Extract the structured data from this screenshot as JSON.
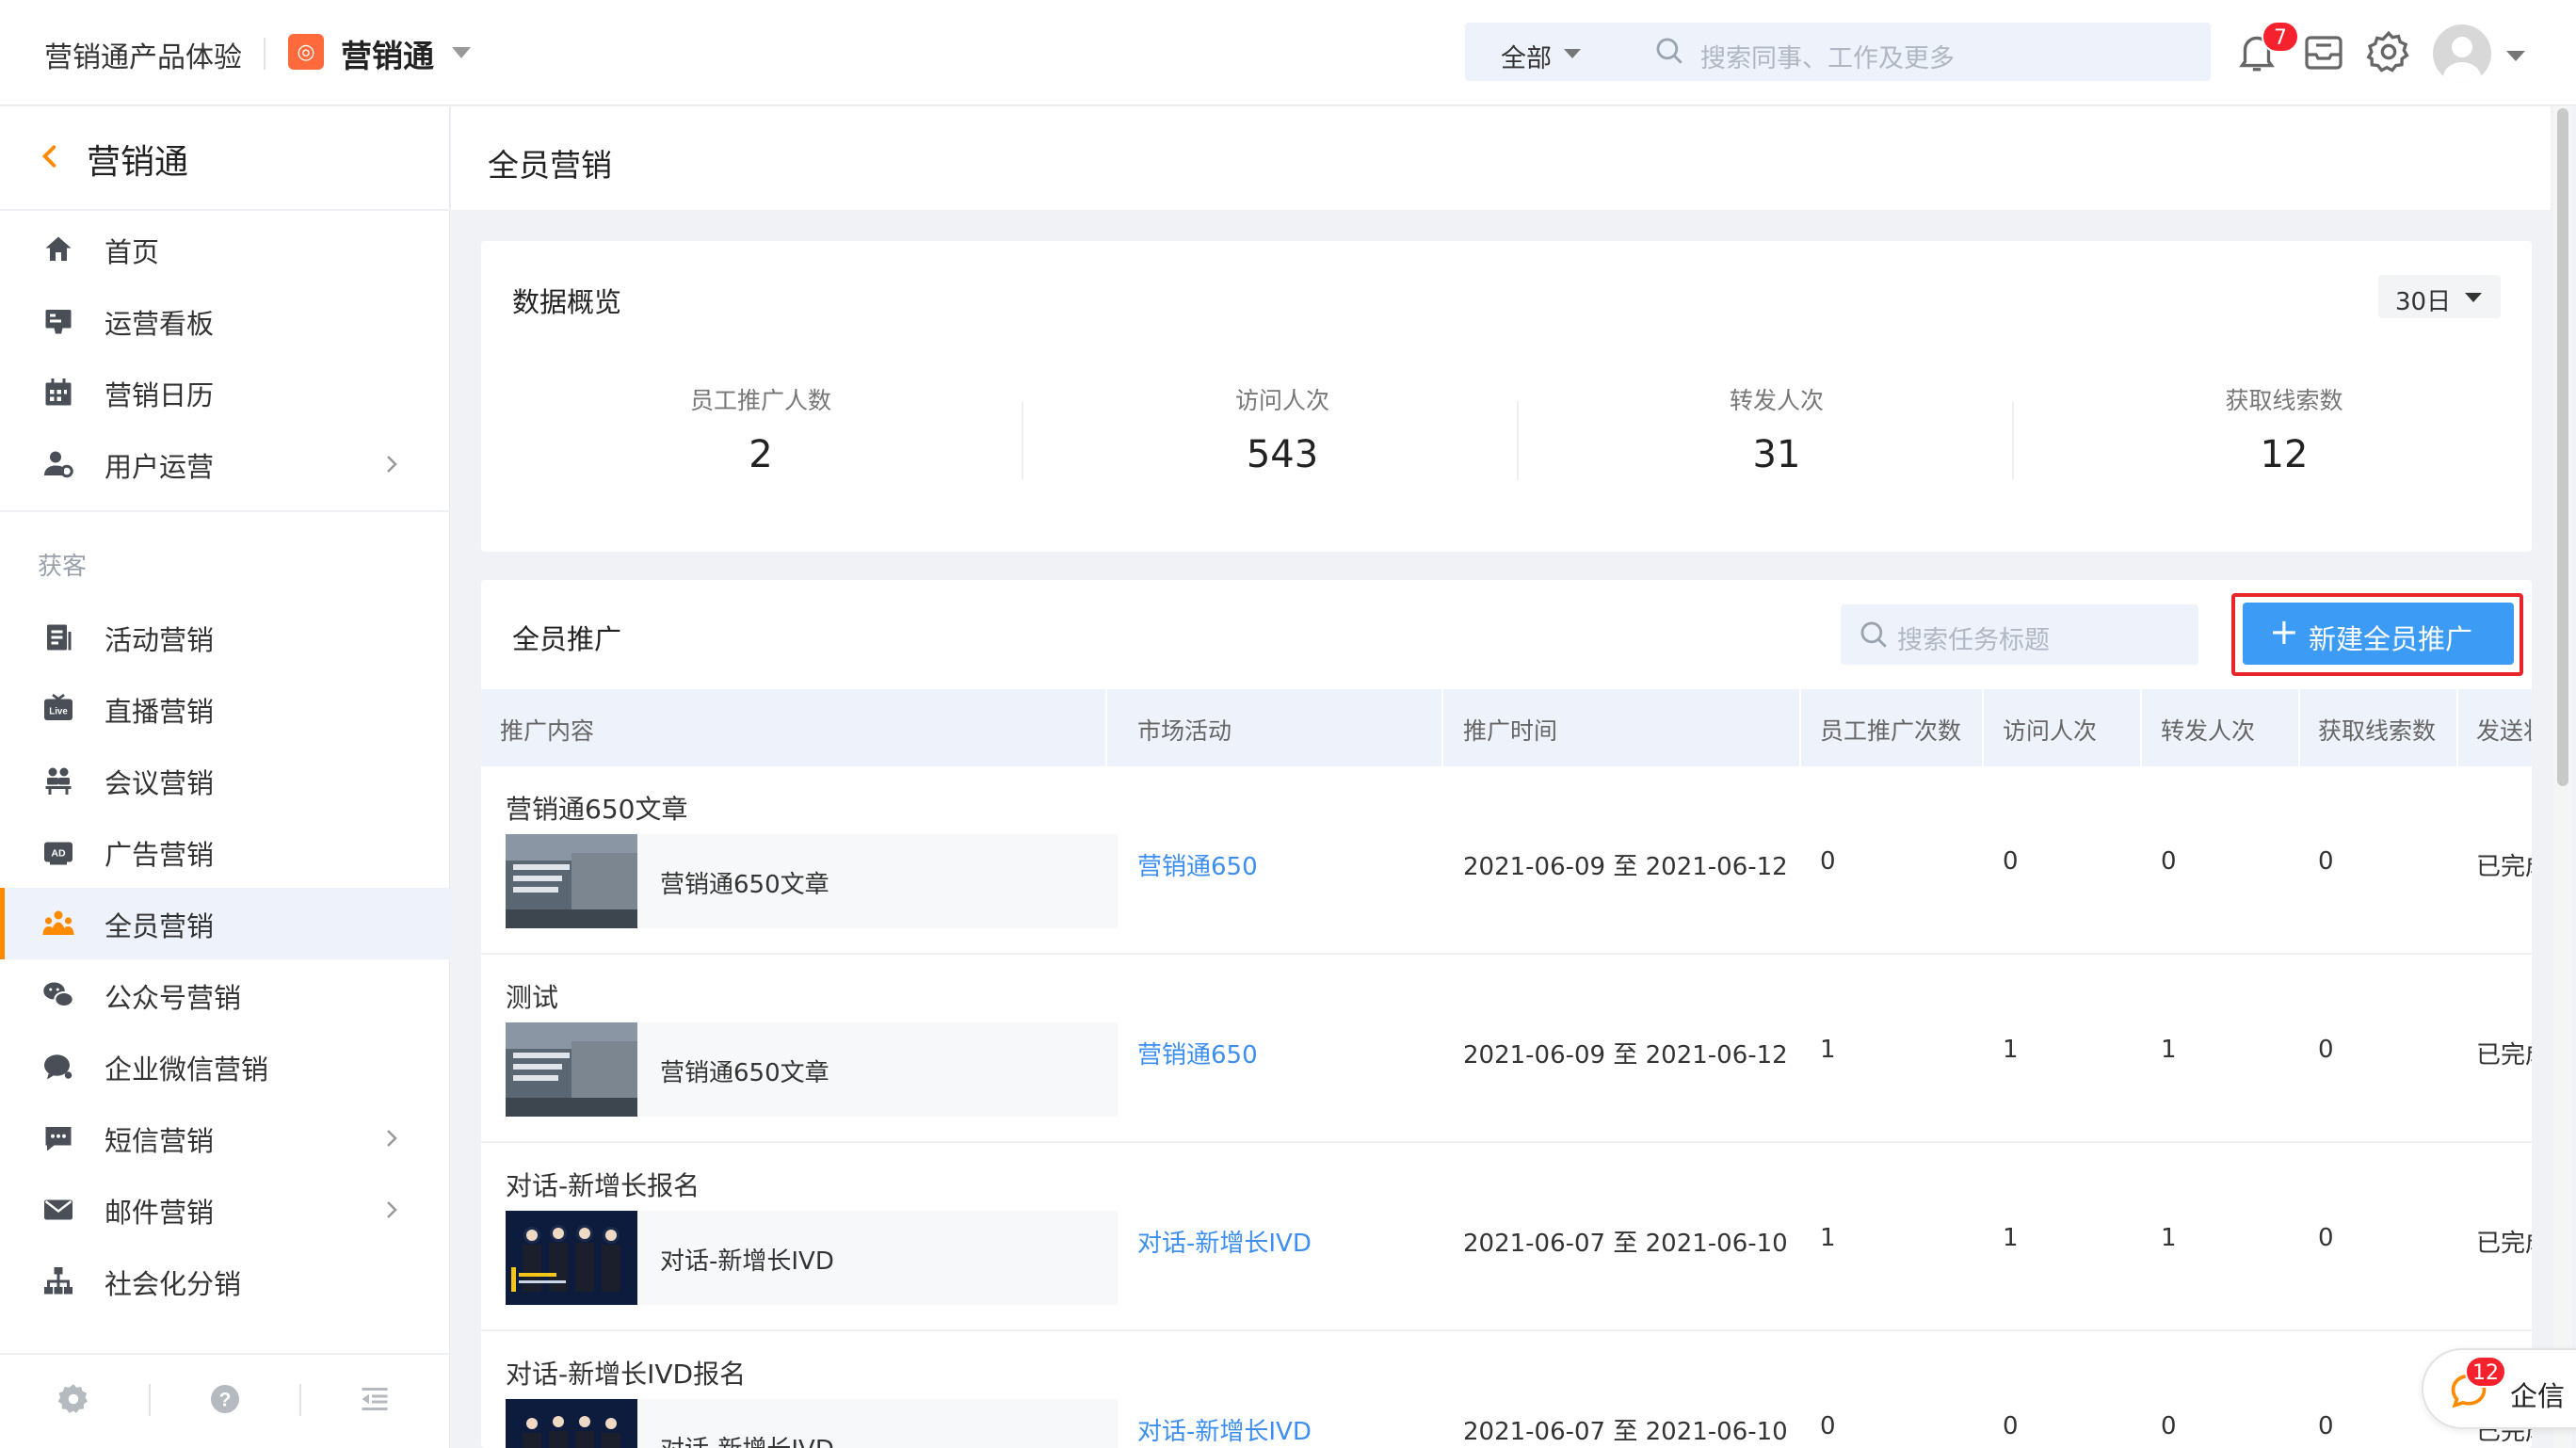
{
  "header": {
    "org": "营销通产品体验",
    "app_name": "营销通",
    "search_scope": "全部",
    "search_placeholder": "搜索同事、工作及更多",
    "notification_count": "7"
  },
  "sidebar": {
    "title": "营销通",
    "items_top": [
      {
        "label": "首页",
        "icon": "home-icon"
      },
      {
        "label": "运营看板",
        "icon": "dashboard-icon"
      },
      {
        "label": "营销日历",
        "icon": "calendar-icon"
      },
      {
        "label": "用户运营",
        "icon": "user-ops-icon",
        "expandable": true
      }
    ],
    "group_label": "获客",
    "items_acq": [
      {
        "label": "活动营销",
        "icon": "activity-icon"
      },
      {
        "label": "直播营销",
        "icon": "live-icon"
      },
      {
        "label": "会议营销",
        "icon": "meeting-icon"
      },
      {
        "label": "广告营销",
        "icon": "ad-icon"
      },
      {
        "label": "全员营销",
        "icon": "team-icon",
        "active": true
      },
      {
        "label": "公众号营销",
        "icon": "wechat-icon"
      },
      {
        "label": "企业微信营销",
        "icon": "wecom-icon"
      },
      {
        "label": "短信营销",
        "icon": "sms-icon",
        "expandable": true
      },
      {
        "label": "邮件营销",
        "icon": "mail-icon",
        "expandable": true
      },
      {
        "label": "社会化分销",
        "icon": "distribution-icon"
      }
    ]
  },
  "page": {
    "title": "全员营销"
  },
  "overview": {
    "title": "数据概览",
    "range": "30日",
    "stats": [
      {
        "label": "员工推广人数",
        "value": "2"
      },
      {
        "label": "访问人次",
        "value": "543"
      },
      {
        "label": "转发人次",
        "value": "31"
      },
      {
        "label": "获取线索数",
        "value": "12"
      }
    ]
  },
  "promotion": {
    "title": "全员推广",
    "search_placeholder": "搜索任务标题",
    "new_button": "新建全员推广",
    "columns": [
      "推广内容",
      "市场活动",
      "推广时间",
      "员工推广次数",
      "访问人次",
      "转发人次",
      "获取线索数",
      "发送状"
    ],
    "rows": [
      {
        "title": "营销通650文章",
        "card": "营销通650文章",
        "campaign": "营销通650",
        "time": "2021-06-09 至 2021-06-12",
        "pushes": "0",
        "visits": "0",
        "forwards": "0",
        "leads": "0",
        "status": "已完成"
      },
      {
        "title": "测试",
        "card": "营销通650文章",
        "campaign": "营销通650",
        "time": "2021-06-09 至 2021-06-12",
        "pushes": "1",
        "visits": "1",
        "forwards": "1",
        "leads": "0",
        "status": "已完成"
      },
      {
        "title": "对话-新增长报名",
        "card": "对话-新增长IVD",
        "campaign": "对话-新增长IVD",
        "time": "2021-06-07 至 2021-06-10",
        "pushes": "1",
        "visits": "1",
        "forwards": "1",
        "leads": "0",
        "status": "已完成"
      },
      {
        "title": "对话-新增长IVD报名",
        "card": "对话-新增长IVD",
        "campaign": "对话-新增长IVD",
        "time": "2021-06-07 至 2021-06-10",
        "pushes": "0",
        "visits": "0",
        "forwards": "0",
        "leads": "0",
        "status": "已完成"
      }
    ]
  },
  "float_chat": {
    "label": "企信",
    "count": "12"
  }
}
